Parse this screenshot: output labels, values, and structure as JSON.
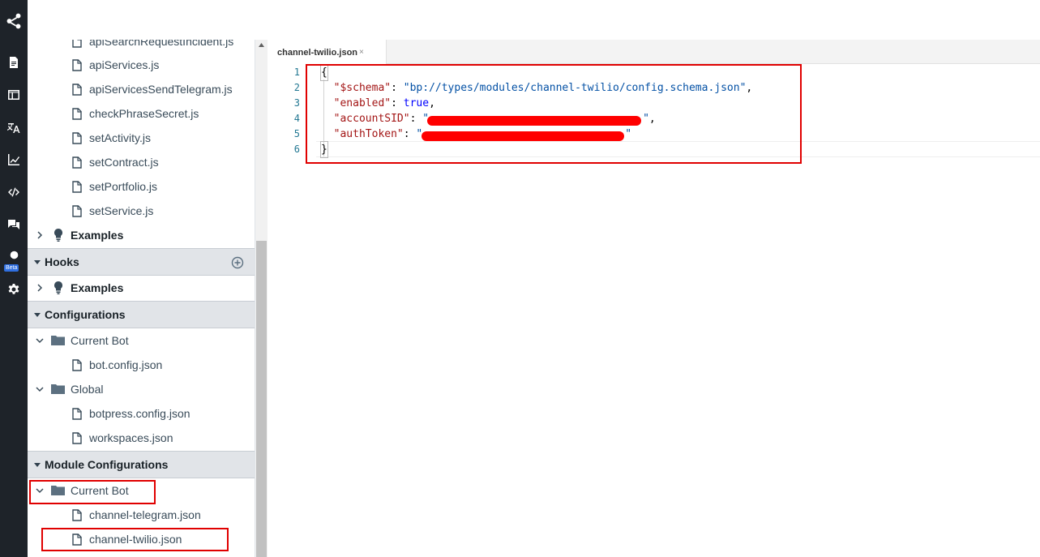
{
  "rail": {
    "items": [
      {
        "name": "share-logo-icon"
      },
      {
        "name": "content-icon"
      },
      {
        "name": "flows-icon"
      },
      {
        "name": "translate-icon"
      },
      {
        "name": "analytics-icon"
      },
      {
        "name": "code-editor-icon"
      },
      {
        "name": "chat-icon"
      },
      {
        "name": "beta-module-icon"
      },
      {
        "name": "settings-icon"
      }
    ],
    "beta_label": "Beta"
  },
  "explorer": {
    "action_files": [
      "apiSearchRequestIncident.js",
      "apiServices.js",
      "apiServicesSendTelegram.js",
      "checkPhraseSecret.js",
      "setActivity.js",
      "setContract.js",
      "setPortfolio.js",
      "setService.js"
    ],
    "actions_examples": "Examples",
    "hooks": {
      "title": "Hooks",
      "examples": "Examples"
    },
    "configurations": {
      "title": "Configurations",
      "current_bot": "Current Bot",
      "current_bot_files": [
        "bot.config.json"
      ],
      "global": "Global",
      "global_files": [
        "botpress.config.json",
        "workspaces.json"
      ]
    },
    "module_configurations": {
      "title": "Module Configurations",
      "current_bot": "Current Bot",
      "files": [
        "channel-telegram.json",
        "channel-twilio.json"
      ]
    }
  },
  "editor": {
    "tab_label": "channel-twilio.json",
    "tab_close": "×",
    "line_numbers": [
      "1",
      "2",
      "3",
      "4",
      "5",
      "6"
    ],
    "code": {
      "open_brace": "{",
      "schema_key": "\"$schema\"",
      "schema_value": "\"bp://types/modules/channel-twilio/config.schema.json\"",
      "enabled_key": "\"enabled\"",
      "enabled_value": "true",
      "account_key": "\"accountSID\"",
      "account_value_open": "\"",
      "account_value_close": "\"",
      "auth_key": "\"authToken\"",
      "auth_value_open": "\"",
      "auth_value_close": "\"",
      "close_brace": "}",
      "colon": ": ",
      "comma": ","
    }
  },
  "colors": {
    "rail_bg": "#1e2329",
    "annotation": "#e00000",
    "redaction": "#ff0000"
  }
}
